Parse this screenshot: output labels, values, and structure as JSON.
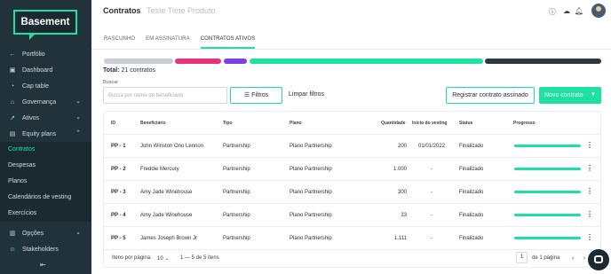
{
  "sidebar": {
    "logo": "Basement",
    "items": [
      {
        "label": "Portfólio",
        "icon": "arrow-left-icon"
      },
      {
        "label": "Dashboard",
        "icon": "dashboard-icon"
      },
      {
        "label": "Cap table",
        "icon": "pie-chart-icon"
      },
      {
        "label": "Governança",
        "icon": "bank-icon"
      },
      {
        "label": "Ativos",
        "icon": "trend-icon"
      },
      {
        "label": "Equity plans",
        "icon": "document-icon"
      }
    ],
    "subitems": [
      "Contratos",
      "Despesas",
      "Planos",
      "Calendários de vesting",
      "Exercícios"
    ],
    "items2": [
      {
        "label": "Opções",
        "icon": "bar-chart-icon"
      },
      {
        "label": "Stakeholders",
        "icon": "people-icon"
      }
    ]
  },
  "header": {
    "title": "Contratos",
    "company": "Teste Time Produto"
  },
  "tabs": [
    "RASCUNHO",
    "EM ASSINATURA",
    "CONTRATOS ATIVOS"
  ],
  "summary": {
    "total_label": "Total:",
    "total_value": "21 contratos"
  },
  "filters": {
    "search_label": "Buscar",
    "search_placeholder": "Busca por nome de beneficiário",
    "filter_button": "Filtros",
    "clear_button": "Limpar filtros",
    "register_button": "Registrar contrato assinado",
    "new_button": "Novo contrato"
  },
  "status_bar_colors": [
    "#c9ced3",
    "#e8337a",
    "#7b3fe4",
    "#1fe0a3",
    "#2b3a42"
  ],
  "table": {
    "headers": [
      "ID",
      "Beneficiário",
      "Tipo",
      "Plano",
      "Quantidade",
      "Início do vesting",
      "Status",
      "Progresso"
    ],
    "rows": [
      {
        "id": "PP - 1",
        "name": "John Winston Ono Lennon",
        "type": "Partnership",
        "plan": "Plano Partnership",
        "qty": "200",
        "start": "01/01/2022",
        "status": "Finalizado",
        "progress": 1
      },
      {
        "id": "PP - 2",
        "name": "Freddie Mercury",
        "type": "Partnership",
        "plan": "Plano Partnership",
        "qty": "1.000",
        "start": "-",
        "status": "Finalizado",
        "progress": 1
      },
      {
        "id": "PP - 3",
        "name": "Amy Jade Winehouse",
        "type": "Partnership",
        "plan": "Plano Partnership",
        "qty": "300",
        "start": "-",
        "status": "Finalizado",
        "progress": 1
      },
      {
        "id": "PP - 4",
        "name": "Amy Jade Winehouse",
        "type": "Partnership",
        "plan": "Plano Partnership",
        "qty": "33",
        "start": "-",
        "status": "Finalizado",
        "progress": 1
      },
      {
        "id": "PP - 5",
        "name": "James Joseph Brown Jr",
        "type": "Partnership",
        "plan": "Plano Partnership",
        "qty": "1.111",
        "start": "-",
        "status": "Finalizado",
        "progress": 1
      }
    ]
  },
  "pagination": {
    "per_page_label": "Itens por página:",
    "per_page_value": "10",
    "range": "1 — 5 de 5 itens",
    "page": "1",
    "of_pages": "de 1 página"
  }
}
